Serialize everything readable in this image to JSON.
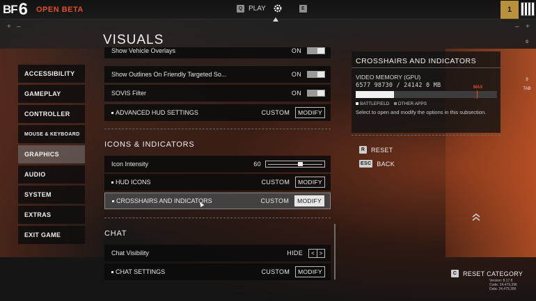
{
  "topbar": {
    "logo_bf": "BF",
    "logo_6": "6",
    "beta_label": "OPEN BETA",
    "play_key": "Q",
    "play_label": "PLAY",
    "right_key": "E",
    "level": "1"
  },
  "page": {
    "title": "VISUALS"
  },
  "sidebar": {
    "items": [
      {
        "label": "ACCESSIBILITY"
      },
      {
        "label": "GAMEPLAY"
      },
      {
        "label": "CONTROLLER"
      },
      {
        "label": "MOUSE & KEYBOARD"
      },
      {
        "label": "GRAPHICS"
      },
      {
        "label": "AUDIO"
      },
      {
        "label": "SYSTEM"
      },
      {
        "label": "EXTRAS"
      },
      {
        "label": "EXIT GAME"
      }
    ],
    "active": "GRAPHICS"
  },
  "settings": {
    "vehicle_overlays": {
      "label": "Show Vehicle Overlays",
      "value": "ON"
    },
    "outlines": {
      "label": "Show Outlines On Friendly Targeted So...",
      "value": "ON"
    },
    "sovis": {
      "label": "SOVIS Filter",
      "value": "ON"
    },
    "advanced_hud": {
      "label": "ADVANCED HUD SETTINGS",
      "value": "CUSTOM",
      "button": "MODIFY"
    },
    "icons_section": "ICONS & INDICATORS",
    "icon_intensity": {
      "label": "Icon Intensity",
      "value": "60",
      "fraction": 0.6
    },
    "hud_icons": {
      "label": "HUD ICONS",
      "value": "CUSTOM",
      "button": "MODIFY"
    },
    "crosshairs": {
      "label": "CROSSHAIRS AND INDICATORS",
      "value": "CUSTOM",
      "button": "MODIFY"
    },
    "chat_section": "CHAT",
    "chat_visibility": {
      "label": "Chat Visibility",
      "value": "HIDE",
      "prev": "<",
      "next": ">"
    },
    "chat_settings": {
      "label": "CHAT SETTINGS",
      "value": "CUSTOM",
      "button": "MODIFY"
    }
  },
  "info": {
    "title": "CROSSHAIRS AND INDICATORS",
    "vm_label": "VIDEO MEMORY (GPU)",
    "vm_values": "6577 98730 / 24142 0 MB",
    "vm_fraction": 0.27,
    "max_label": "MAX",
    "legend_battlefield": "BATTLEFIELD",
    "legend_other": "OTHER APPS",
    "description": "Select to open and modify the options in this subsection.",
    "battlefield_color": "#f2f2f2",
    "other_color": "#8a8a8a",
    "max_color": "#e0502a"
  },
  "actions": {
    "reset_key": "R",
    "reset_label": "RESET",
    "back_key": "ESC",
    "back_label": "BACK",
    "reset_category_key": "C",
    "reset_category_label": "RESET CATEGORY"
  },
  "version": {
    "line1": "Version: 8.17.8",
    "line2": "Code: 24,479,396",
    "line3": "Data: 24,479,396"
  },
  "hud_right": {
    "top": "0",
    "mid": "9",
    "tab": "TAB"
  }
}
